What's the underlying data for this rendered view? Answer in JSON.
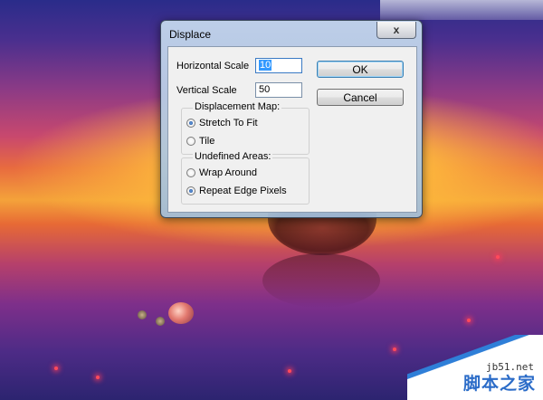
{
  "dialog": {
    "title": "Displace",
    "close_label": "x",
    "horizontal_scale": {
      "label": "Horizontal Scale",
      "value": "10"
    },
    "vertical_scale": {
      "label": "Vertical Scale",
      "value": "50"
    },
    "ok_label": "OK",
    "cancel_label": "Cancel",
    "displacement_map": {
      "title": "Displacement Map:",
      "options": [
        {
          "label": "Stretch To Fit",
          "selected": true
        },
        {
          "label": "Tile",
          "selected": false
        }
      ]
    },
    "undefined_areas": {
      "title": "Undefined Areas:",
      "options": [
        {
          "label": "Wrap Around",
          "selected": false
        },
        {
          "label": "Repeat Edge Pixels",
          "selected": true
        }
      ]
    }
  },
  "watermark": {
    "site": "jb51.net",
    "name": "脚本之家",
    "accent_color": "#2f7fd8"
  }
}
